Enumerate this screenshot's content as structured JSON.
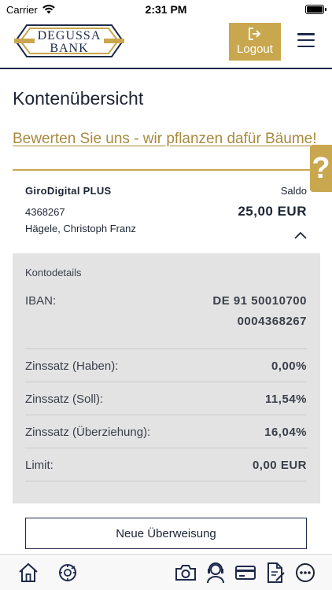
{
  "status_bar": {
    "carrier": "Carrier",
    "time": "2:31 PM",
    "wifi_icon": "wifi-icon",
    "battery_icon": "battery-full-icon"
  },
  "header": {
    "logo": {
      "line1": "DEGUSSA",
      "line2": "BANK",
      "colors": {
        "navy": "#1e2a4a",
        "gold": "#c9a74f"
      }
    },
    "logout_label": "Logout",
    "logout_icon": "sign-out-icon",
    "menu_icon": "hamburger-menu-icon"
  },
  "page": {
    "title": "Kontenübersicht",
    "rating_link": "Bewerten Sie uns - wir pflanzen dafür Bäume!",
    "help_label": "?"
  },
  "account": {
    "name": "GiroDigital PLUS",
    "saldo_label": "Saldo",
    "number": "4368267",
    "holder": "Hägele, Christoph Franz",
    "balance": "25,00 EUR",
    "expand_icon": "chevron-up-icon"
  },
  "details": {
    "heading": "Kontodetails",
    "iban_label": "IBAN:",
    "iban_line1": "DE 91 50010700",
    "iban_line2": "0004368267",
    "rows": [
      {
        "label": "Zinssatz (Haben):",
        "value": "0,00%"
      },
      {
        "label": "Zinssatz (Soll):",
        "value": "11,54%"
      },
      {
        "label": "Zinssatz (Überziehung):",
        "value": "16,04%"
      },
      {
        "label": "Limit:",
        "value": "0,00 EUR"
      }
    ]
  },
  "actions": {
    "transfer_label": "Neue Überweisung"
  },
  "bottom_nav": [
    {
      "icon": "home-icon"
    },
    {
      "icon": "gear-refresh-icon"
    },
    {
      "icon": "camera-icon"
    },
    {
      "icon": "support-agent-icon"
    },
    {
      "icon": "credit-card-icon"
    },
    {
      "icon": "document-sign-icon"
    },
    {
      "icon": "more-icon"
    }
  ],
  "colors": {
    "accent_gold": "#c9a74f",
    "link_gold": "#a8893d",
    "navy": "#1e2a4a",
    "panel_gray": "#e3e3e3"
  }
}
